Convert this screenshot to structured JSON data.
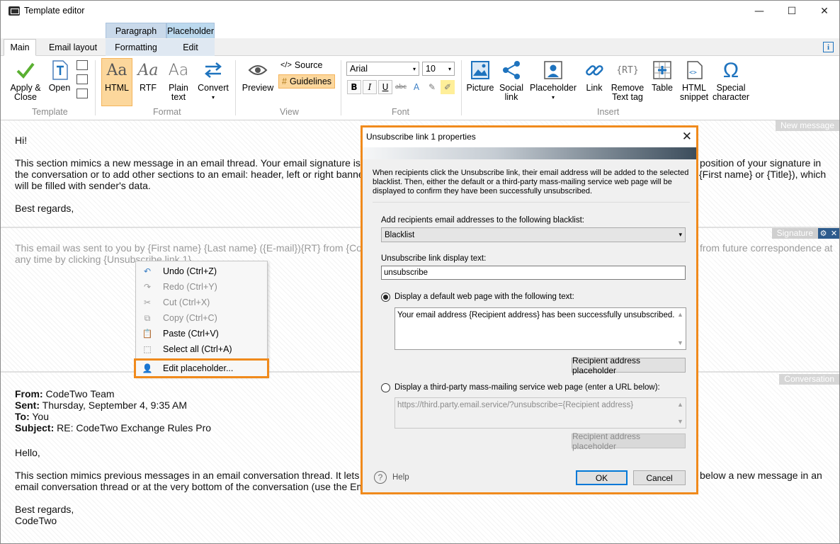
{
  "window": {
    "title": "Template editor",
    "minimize": "—",
    "maximize": "☐",
    "close": "✕"
  },
  "context_groups": {
    "paragraph": "Paragraph",
    "placeholder": "Placeholder"
  },
  "tabs": {
    "main": "Main",
    "email_layout": "Email layout",
    "formatting": "Formatting",
    "edit": "Edit"
  },
  "ribbon": {
    "template": {
      "apply": "Apply &\nClose",
      "open": "Open",
      "group": "Template"
    },
    "format": {
      "html": "HTML",
      "rtf": "RTF",
      "plain": "Plain\ntext",
      "convert": "Convert",
      "group": "Format"
    },
    "view": {
      "preview": "Preview",
      "source": "Source",
      "guidelines": "Guidelines",
      "group": "View"
    },
    "font": {
      "family": "Arial",
      "size": "10",
      "bold": "B",
      "italic": "I",
      "underline": "U",
      "strike": "abc",
      "group": "Font"
    },
    "insert": {
      "picture": "Picture",
      "social": "Social\nlink",
      "placeholder": "Placeholder",
      "link": "Link",
      "remove_rt": "Remove\nText tag",
      "table": "Table",
      "html_snippet": "HTML\nsnippet",
      "special": "Special\ncharacter",
      "group": "Insert"
    }
  },
  "sections": {
    "new_message": {
      "tag": "New message",
      "greeting": "Hi!",
      "body_line1": "This section mimics a new message in an email thread. Your email signature is sho",
      "body_line1_right": "position of your signature in",
      "body_line2": "the conversation or to add other sections to an email: header, left or right banners. Th",
      "body_line2_right": "{First name} or {Title}), which",
      "body_line3": "will be filled with sender's data.",
      "closing": "Best regards,"
    },
    "signature": {
      "tag": "Signature",
      "line1": "This email was sent to you by {First name} {Last name} ({E-mail}){RT} from {Compan",
      "line1_right": "from future correspondence at",
      "line2": "any time by clicking {Unsubscribe link 1}"
    },
    "conversation": {
      "tag": "Conversation",
      "from_label": "From:",
      "from_value": " CodeTwo Team",
      "sent_label": "Sent:",
      "sent_value": " Thursday, September 4, 9:35 AM",
      "to_label": "To:",
      "to_value": " You",
      "subject_label": "Subject:",
      "subject_value": " RE: CodeTwo Exchange Rules Pro",
      "hello": "Hello,",
      "body_line1": "This section mimics previous messages in an email conversation thread. It lets you s",
      "body_line1_right": "below a new message in an",
      "body_line2": "email conversation thread or at the very bottom of the conversation (use the Email lay",
      "closing1": "Best regards,",
      "closing2": "CodeTwo"
    }
  },
  "context_menu": {
    "items": [
      {
        "label": "Undo (Ctrl+Z)",
        "icon": "↶",
        "disabled": false
      },
      {
        "label": "Redo (Ctrl+Y)",
        "icon": "↷",
        "disabled": true
      },
      {
        "label": "Cut (Ctrl+X)",
        "icon": "✂",
        "disabled": true
      },
      {
        "label": "Copy (Ctrl+C)",
        "icon": "⧉",
        "disabled": true
      },
      {
        "label": "Paste (Ctrl+V)",
        "icon": "📋",
        "disabled": false
      },
      {
        "label": "Select all (Ctrl+A)",
        "icon": "⬚",
        "disabled": false
      },
      {
        "label": "Edit placeholder...",
        "icon": "👤",
        "disabled": false
      }
    ]
  },
  "dialog": {
    "title": "Unsubscribe link 1 properties",
    "description": "When recipients click the Unsubscribe link, their email address will be added to the selected blacklist. Then, either the default or a third-party mass-mailing service web page will be displayed to confirm they have been successfully unsubscribed.",
    "blacklist_label": "Add recipients email addresses to the following blacklist:",
    "blacklist_value": "Blacklist",
    "display_text_label": "Unsubscribe link display text:",
    "display_text_value": "unsubscribe",
    "option_default": "Display a default web page with the following text:",
    "default_text": "Your email address {Recipient address} has been successfully unsubscribed.",
    "recipient_placeholder_btn": "Recipient address placeholder",
    "option_third_party": "Display a third-party mass-mailing service web page (enter a URL below):",
    "third_party_url": "https://third.party.email.service/?unsubscribe={Recipient address}",
    "help": "Help",
    "ok": "OK",
    "cancel": "Cancel"
  }
}
